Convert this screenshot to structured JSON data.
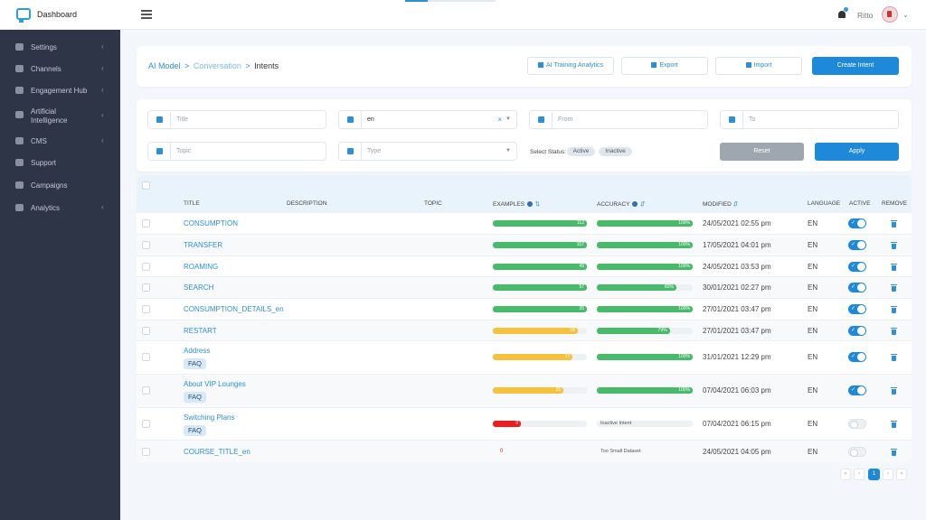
{
  "app": {
    "brand": "Dashboard",
    "user": "Ritto",
    "progress": 0.25
  },
  "sidebar": {
    "items": [
      {
        "label": "Settings",
        "icon": "gears-icon",
        "chevron": true
      },
      {
        "label": "Channels",
        "icon": "globe-icon",
        "chevron": true
      },
      {
        "label": "Engagement Hub",
        "icon": "chat-icon",
        "chevron": true
      },
      {
        "label": "Artificial Intelligence",
        "icon": "brain-icon",
        "chevron": true
      },
      {
        "label": "CMS",
        "icon": "cms-icon",
        "chevron": true
      },
      {
        "label": "Support",
        "icon": "globe-icon",
        "chevron": false
      },
      {
        "label": "Campaigns",
        "icon": "broadcast-icon",
        "chevron": false
      },
      {
        "label": "Analytics",
        "icon": "chart-icon",
        "chevron": true
      }
    ]
  },
  "breadcrumb": {
    "part1": "AI Model",
    "part2": "Conversation",
    "part3": "Intents",
    "sep": ">"
  },
  "header_buttons": {
    "analytics": "AI Training Analytics",
    "export": "Export",
    "import": "Import",
    "create": "Create Intent"
  },
  "filters": {
    "title_placeholder": "Title",
    "language_value": "en",
    "clear_symbol": "×",
    "from_placeholder": "From",
    "to_placeholder": "To",
    "topic_placeholder": "Topic",
    "type_placeholder": "Type",
    "status_label": "Select Status:",
    "status_active": "Active",
    "status_inactive": "Inactive",
    "reset": "Reset",
    "apply": "Apply"
  },
  "table": {
    "headers": {
      "title": "TITLE",
      "description": "DESCRIPTION",
      "topic": "TOPIC",
      "examples": "EXAMPLES",
      "accuracy": "ACCURACY",
      "modified": "MODIFIED",
      "language": "LANGUAGE",
      "active": "ACTIVE",
      "remove": "REMOVE"
    },
    "rows": [
      {
        "title": "CONSUMPTION",
        "faq": "",
        "examples": "112",
        "ex_frac": 1.0,
        "ex_color": "#48bb6a",
        "accuracy": "100%",
        "acc_frac": 1.0,
        "acc_text": "",
        "modified": "24/05/2021 02:55 pm",
        "language": "EN",
        "active": true
      },
      {
        "title": "TRANSFER",
        "faq": "",
        "examples": "107",
        "ex_frac": 1.0,
        "ex_color": "#48bb6a",
        "accuracy": "100%",
        "acc_frac": 1.0,
        "acc_text": "",
        "modified": "17/05/2021 04:01 pm",
        "language": "EN",
        "active": true
      },
      {
        "title": "ROAMING",
        "faq": "",
        "examples": "49",
        "ex_frac": 1.0,
        "ex_color": "#48bb6a",
        "accuracy": "100%",
        "acc_frac": 1.0,
        "acc_text": "",
        "modified": "24/05/2021 03:53 pm",
        "language": "EN",
        "active": true
      },
      {
        "title": "SEARCH",
        "faq": "",
        "examples": "57",
        "ex_frac": 1.0,
        "ex_color": "#48bb6a",
        "accuracy": "83%",
        "acc_frac": 0.83,
        "acc_text": "",
        "modified": "30/01/2021 02:27 pm",
        "language": "EN",
        "active": true
      },
      {
        "title": "CONSUMPTION_DETAILS_en",
        "faq": "",
        "examples": "35",
        "ex_frac": 1.0,
        "ex_color": "#48bb6a",
        "accuracy": "100%",
        "acc_frac": 1.0,
        "acc_text": "",
        "modified": "27/01/2021 03:47 pm",
        "language": "EN",
        "active": true
      },
      {
        "title": "RESTART",
        "faq": "",
        "examples": "18",
        "ex_frac": 0.9,
        "ex_color": "#f6c23e",
        "accuracy": "79%",
        "acc_frac": 0.76,
        "acc_text": "",
        "modified": "27/01/2021 03:47 pm",
        "language": "EN",
        "active": true
      },
      {
        "title": "Address",
        "faq": "FAQ",
        "examples": "17",
        "ex_frac": 0.85,
        "ex_color": "#f6c23e",
        "accuracy": "100%",
        "acc_frac": 1.0,
        "acc_text": "",
        "modified": "31/01/2021 12:29 pm",
        "language": "EN",
        "active": true
      },
      {
        "title": "About VIP Lounges",
        "faq": "FAQ",
        "examples": "15",
        "ex_frac": 0.75,
        "ex_color": "#f6c23e",
        "accuracy": "100%",
        "acc_frac": 1.0,
        "acc_text": "",
        "modified": "07/04/2021 06:03 pm",
        "language": "EN",
        "active": true
      },
      {
        "title": "Switching Plans",
        "faq": "FAQ",
        "examples": "0",
        "ex_frac": 0.3,
        "ex_color": "#ee1d1d",
        "accuracy": "",
        "acc_frac": 0,
        "acc_text": "Inactive Intent",
        "modified": "07/04/2021 06:15 pm",
        "language": "EN",
        "active": false
      },
      {
        "title": "COURSE_TITLE_en",
        "faq": "",
        "examples": "0",
        "ex_frac": 0,
        "ex_color": "#ee1d1d",
        "accuracy": "",
        "acc_frac": 0,
        "acc_text": "Too Small Dataset",
        "modified": "24/05/2021 04:05 pm",
        "language": "EN",
        "active": false
      }
    ]
  },
  "pagination": {
    "first": "«",
    "prev": "‹",
    "current": "1",
    "next": "›",
    "last": "»"
  }
}
